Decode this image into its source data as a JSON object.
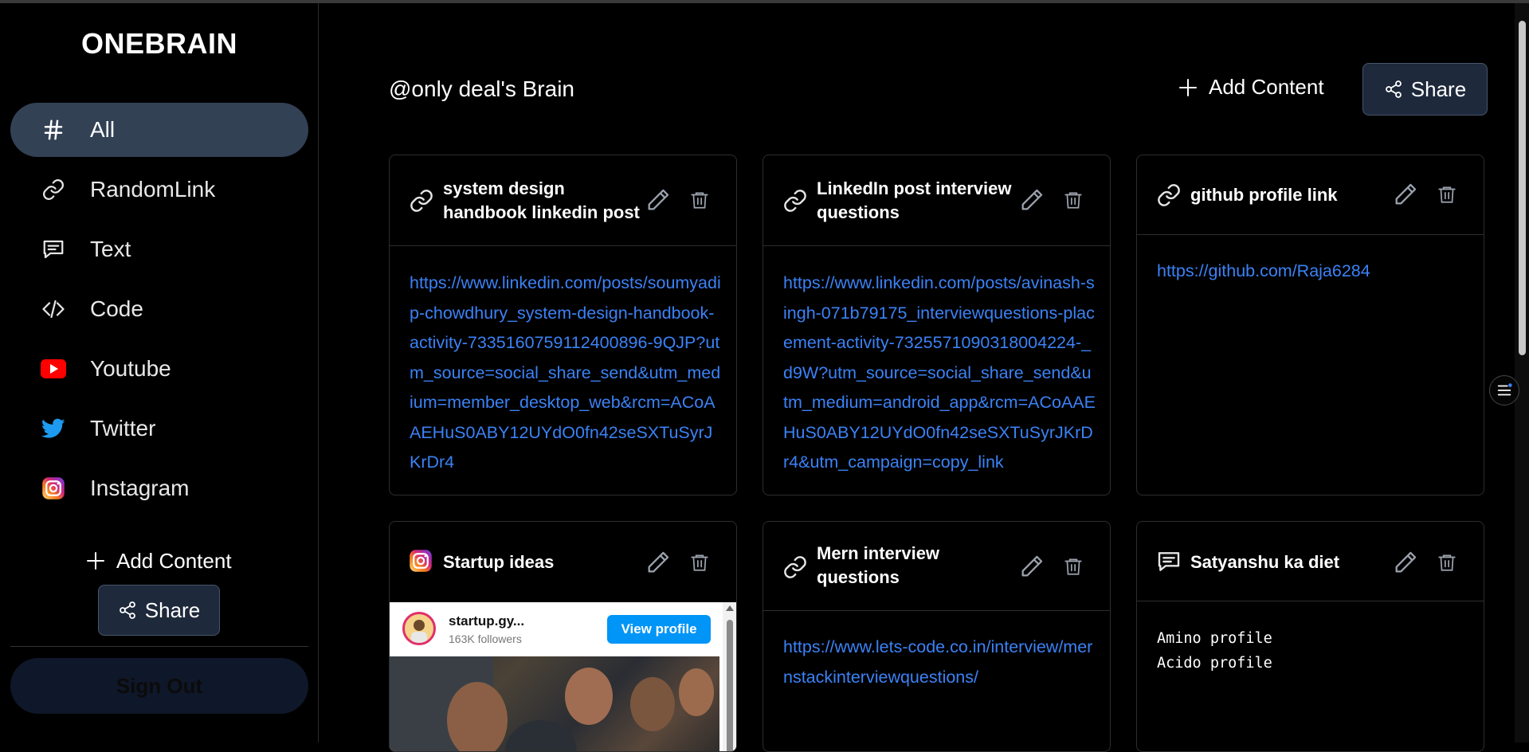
{
  "sidebar": {
    "logo": "ONEBRAIN",
    "items": [
      {
        "label": "All",
        "icon": "hash-icon",
        "active": true
      },
      {
        "label": "RandomLink",
        "icon": "link-icon"
      },
      {
        "label": "Text",
        "icon": "message-icon"
      },
      {
        "label": "Code",
        "icon": "code-icon"
      },
      {
        "label": "Youtube",
        "icon": "youtube-icon"
      },
      {
        "label": "Twitter",
        "icon": "twitter-icon"
      },
      {
        "label": "Instagram",
        "icon": "instagram-icon"
      }
    ],
    "add_content_label": "Add Content",
    "share_label": "Share",
    "sign_out_label": "Sign Out"
  },
  "header": {
    "title": "@only deal's Brain",
    "add_content_label": "Add Content",
    "share_label": "Share"
  },
  "cards": [
    {
      "title": "system design handbook linkedin post",
      "type_icon": "link-icon",
      "content": "https://www.linkedin.com/posts/soumyadip-chowdhury_system-design-handbook-activity-7335160759112400896-9QJP?utm_source=social_share_send&utm_medium=member_desktop_web&rcm=ACoAAEHuS0ABY12UYdO0fn42seSXTuSyrJKrDr4"
    },
    {
      "title": "LinkedIn post interview questions",
      "type_icon": "link-icon",
      "content": "https://www.linkedin.com/posts/avinash-singh-071b79175_interviewquestions-placement-activity-7325571090318004224-_d9W?utm_source=social_share_send&utm_medium=android_app&rcm=ACoAAEHuS0ABY12UYdO0fn42seSXTuSyrJKrDr4&utm_campaign=copy_link"
    },
    {
      "title": "github profile link",
      "type_icon": "link-icon",
      "content": "https://github.com/Raja6284"
    },
    {
      "title": "Startup ideas",
      "type_icon": "instagram-icon",
      "embed": {
        "account": "startup.gy...",
        "followers": "163K followers",
        "button": "View profile"
      }
    },
    {
      "title": "Mern interview questions",
      "type_icon": "link-icon",
      "content": "https://www.lets-code.co.in/interview/mernstackinterviewquestions/"
    },
    {
      "title": "Satyanshu ka diet",
      "type_icon": "message-icon",
      "content": "Amino profile\nAcido profile"
    }
  ],
  "colors": {
    "background": "#000000",
    "accent_active": "#334155",
    "button_bg": "#1e293b",
    "link": "#3b82f6",
    "youtube": "#ff0000",
    "twitter": "#1d9bf0"
  }
}
